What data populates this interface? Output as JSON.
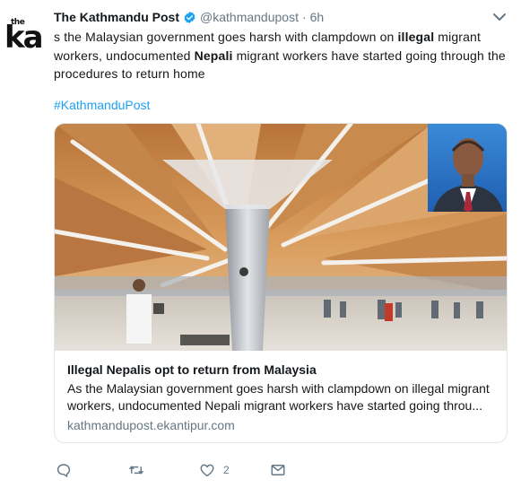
{
  "account": {
    "avatar_word_small": "the",
    "avatar_word_large": "ka",
    "name": "The Kathmandu Post",
    "handle": "@kathmandupost",
    "separator": "·",
    "time": "6h"
  },
  "tweet": {
    "text_part1": "s the Malaysian government goes harsh with clampdown on ",
    "text_bold1": "illegal",
    "text_part2": " migrant workers, undocumented ",
    "text_bold2": "Nepali",
    "text_part3": " migrant workers have started going through the procedures to return home",
    "hashtag": "#KathmanduPost"
  },
  "card": {
    "title": "Illegal Nepalis opt to return from Malaysia",
    "description": "As the Malaysian government goes harsh with clampdown on illegal migrant workers, undocumented Nepali migrant workers have started going throu...",
    "domain": "kathmandupost.ekantipur.com"
  },
  "actions": {
    "reply_icon": "reply-icon",
    "retweet_icon": "retweet-icon",
    "like_icon": "heart-icon",
    "like_count": "2",
    "dm_icon": "envelope-icon"
  },
  "colors": {
    "link": "#1da1f2",
    "muted": "#657786",
    "text": "#14171a",
    "border": "#e1e8ed"
  }
}
